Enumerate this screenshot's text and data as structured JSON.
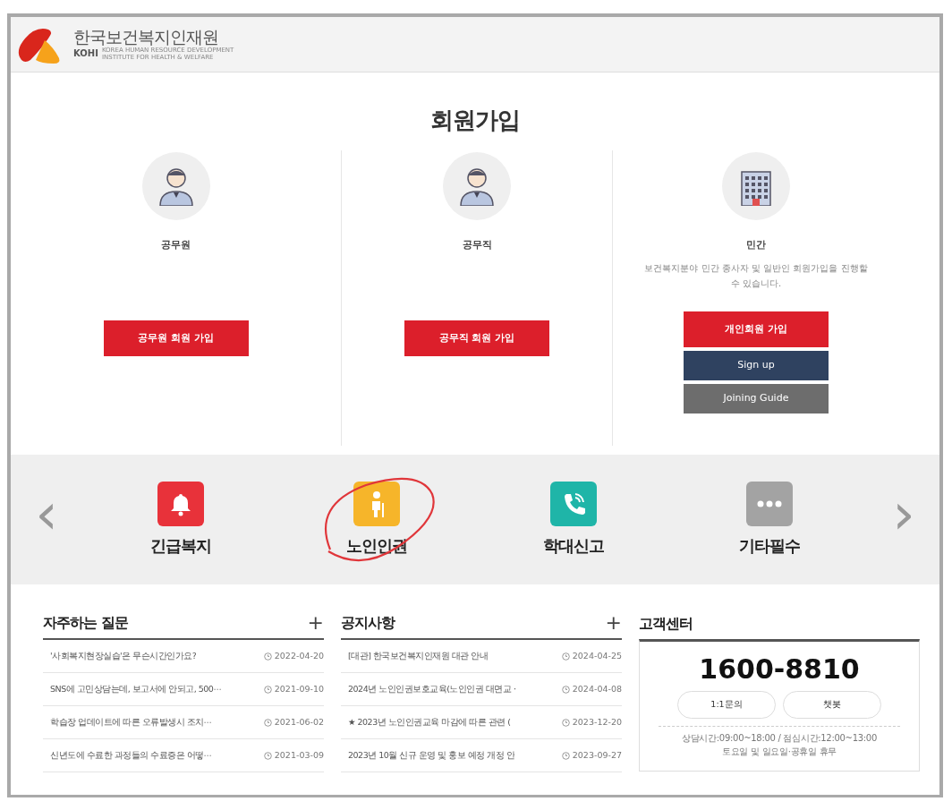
{
  "header": {
    "logo_title": "한국보건복지인재원",
    "logo_subtitle": "KOHI",
    "logo_tagline": "KOREA HUMAN RESOURCE DEVELOPMENT INSTITUTE FOR HEALTH & WELFARE"
  },
  "page_title": "회원가입",
  "member_types": [
    {
      "label": "공무원",
      "kind": "person",
      "buttons": [
        {
          "label": "공무원 회원 가입",
          "kind": "primary"
        }
      ]
    },
    {
      "label": "공무직",
      "kind": "person",
      "buttons": [
        {
          "label": "공무직 회원 가입",
          "kind": "primary"
        }
      ]
    },
    {
      "label": "민간",
      "kind": "building",
      "description": "보건복지분야 민간 종사자 및 일반인 회원가입을 진행할 수 있습니다.",
      "buttons": [
        {
          "label": "개인회원 가입",
          "kind": "primary"
        },
        {
          "label": "Sign up",
          "kind": "navy"
        },
        {
          "label": "Joining Guide",
          "kind": "gray"
        }
      ]
    }
  ],
  "quick_menu": {
    "prev": "‹",
    "next": "›",
    "items": [
      {
        "label": "긴급복지",
        "kind": "bell",
        "color": "#e8323a",
        "circled": false
      },
      {
        "label": "노인인권",
        "kind": "elder",
        "color": "#f6b52a",
        "circled": true
      },
      {
        "label": "학대신고",
        "kind": "phone",
        "color": "#1fb5a8",
        "circled": false
      },
      {
        "label": "기타필수",
        "kind": "more",
        "color": "#a3a3a3",
        "circled": false
      }
    ]
  },
  "faq": {
    "title": "자주하는 질문",
    "more": "+",
    "items": [
      {
        "title": "'사회복지현장실습'은 무슨시간인가요?",
        "date": "2022-04-20"
      },
      {
        "title": "SNS에 고민상담는데, 보고서에 안되고, 500⋯",
        "date": "2021-09-10"
      },
      {
        "title": "학습장 업데이트에 따른 오류발생시 조치⋯",
        "date": "2021-06-02"
      },
      {
        "title": "신년도에 수료한 과정들의 수료증은 어떻⋯",
        "date": "2021-03-09"
      }
    ]
  },
  "notices": {
    "title": "공지사항",
    "more": "+",
    "items": [
      {
        "title": "[대관] 한국보건복지인재원 대관 안내",
        "date": "2024-04-25"
      },
      {
        "title": "2024년 노인인권보호교육(노인인권 대면교 ·",
        "date": "2024-04-08"
      },
      {
        "title": "★ 2023년 노인인권교육 마감에 따른 관련 (",
        "date": "2023-12-20"
      },
      {
        "title": "2023년 10월 신규 운영 및 홍보 예정 개정 안",
        "date": "2023-09-27"
      }
    ]
  },
  "customer_center": {
    "title": "고객센터",
    "phone": "1600-8810",
    "buttons": [
      "1:1문의",
      "챗봇"
    ],
    "hours": [
      "상담시간:09:00~18:00 / 점심시간:12:00~13:00",
      "토요일 및 일요일·공휴일 휴무"
    ]
  }
}
